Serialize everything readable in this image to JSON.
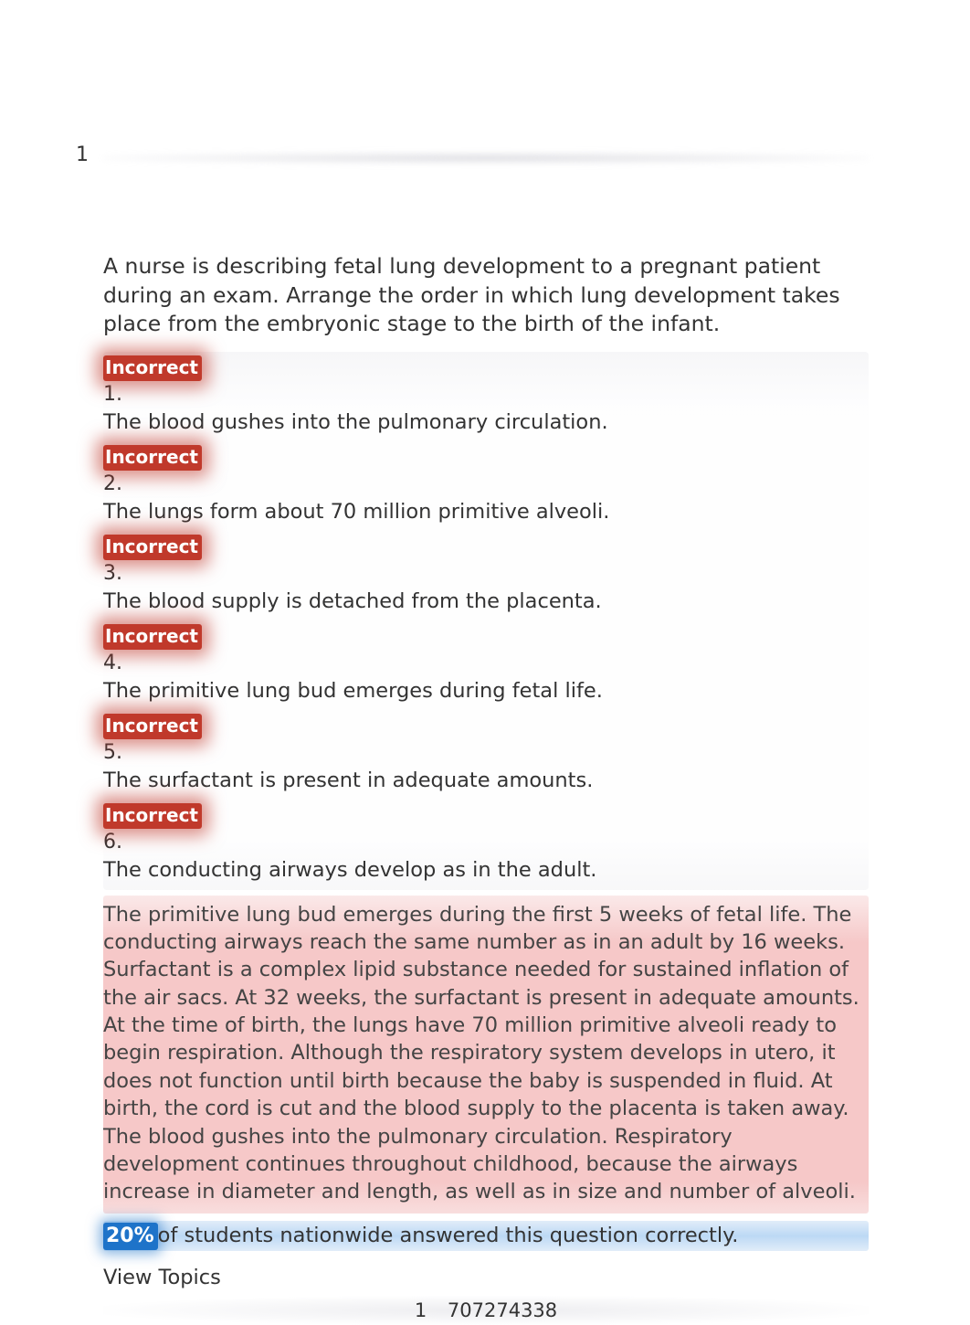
{
  "page_number_top": "1",
  "question": "A nurse is describing fetal lung development to a pregnant patient during an exam. Arrange the order in which lung development takes place from the embryonic stage to the birth of the infant.",
  "badge_label": "Incorrect",
  "answers": [
    {
      "num": "1.",
      "text": "The blood gushes into the pulmonary circulation."
    },
    {
      "num": "2.",
      "text": "The lungs form about 70 million primitive alveoli."
    },
    {
      "num": "3.",
      "text": "The blood supply is detached from the placenta."
    },
    {
      "num": "4.",
      "text": "The primitive lung bud emerges during fetal life."
    },
    {
      "num": "5.",
      "text": "The surfactant is present in adequate amounts."
    },
    {
      "num": "6.",
      "text": "The conducting airways develop as in the adult."
    }
  ],
  "explanation": "The primitive lung bud emerges during the first 5 weeks of fetal life. The conducting airways reach the same number as in an adult by 16 weeks. Surfactant is a complex lipid substance needed for sustained inflation of the air sacs. At 32 weeks, the surfactant is present in adequate amounts. At the time of birth, the lungs have 70 million primitive alveoli ready to begin respiration. Although the respiratory system develops in utero, it does not function until birth because the baby is suspended in fluid. At birth, the cord is cut and the blood supply to the placenta is taken away. The blood gushes into the pulmonary circulation. Respiratory development continues throughout childhood, because the airways increase in diameter and length, as well as in size and number of alveoli.",
  "stats": {
    "percent": "20%",
    "text": "of students nationwide answered this question correctly."
  },
  "view_topics": "View Topics",
  "footer": {
    "left": "1",
    "right": "707274338"
  }
}
